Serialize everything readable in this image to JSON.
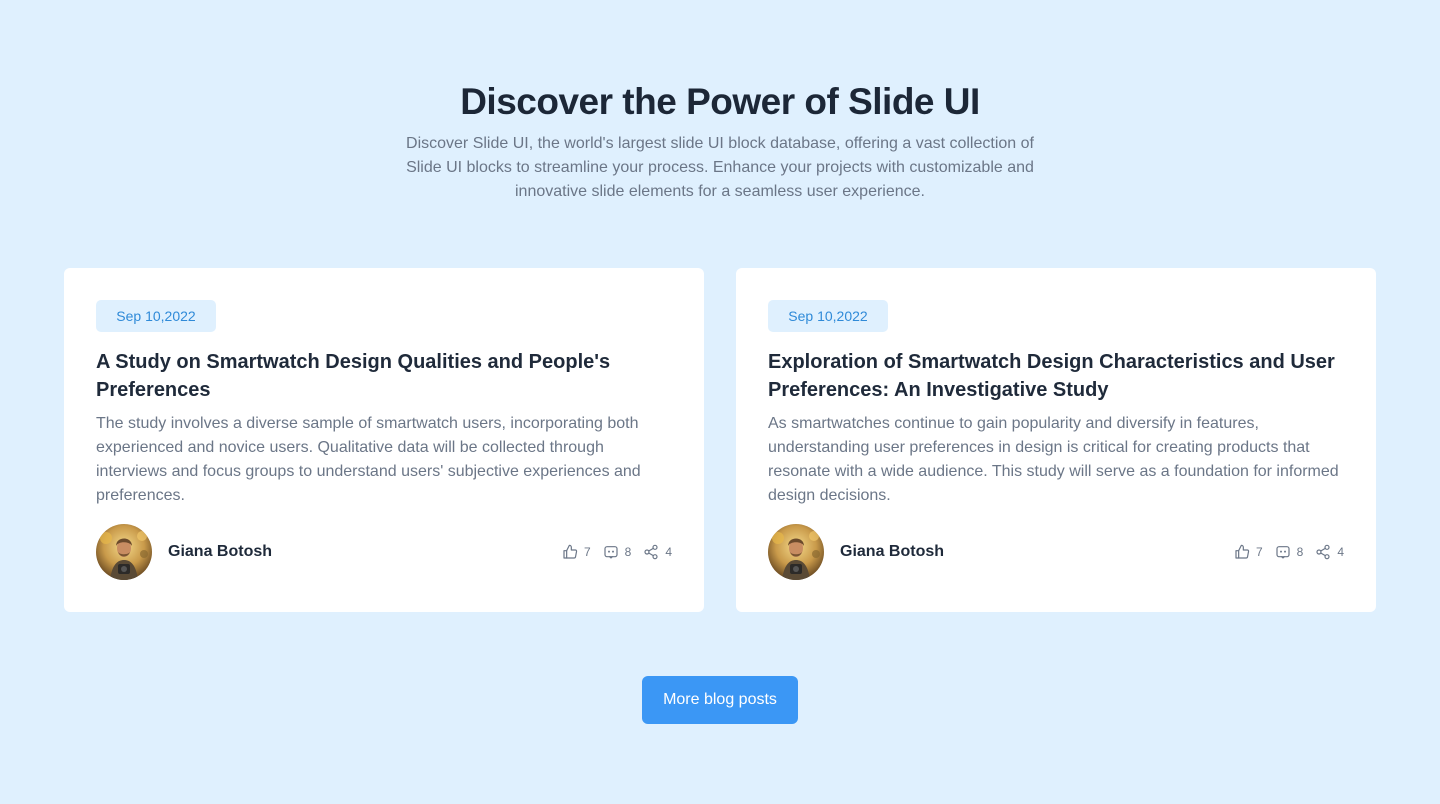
{
  "hero": {
    "title": "Discover the Power of Slide UI",
    "subtitle": "Discover Slide UI, the world's largest slide UI block database, offering a vast collection of Slide UI blocks to streamline your process. Enhance your projects with customizable and innovative slide elements for a seamless user experience."
  },
  "posts": [
    {
      "date": "Sep 10,2022",
      "title": "A Study on Smartwatch Design Qualities and People's Preferences",
      "excerpt": "The study involves a diverse sample of smartwatch users, incorporating both experienced and novice users. Qualitative data will be collected through interviews and focus groups to understand users' subjective experiences and preferences.",
      "author": "Giana Botosh",
      "likes": "7",
      "comments": "8",
      "shares": "4"
    },
    {
      "date": "Sep 10,2022",
      "title": "Exploration of Smartwatch Design Characteristics and User Preferences: An Investigative Study",
      "excerpt": "As smartwatches continue to gain popularity and diversify in features, understanding user preferences in design is critical for creating products that resonate with a wide audience. This study will serve as a foundation for informed design decisions.",
      "author": "Giana Botosh",
      "likes": "7",
      "comments": "8",
      "shares": "4"
    }
  ],
  "more_button": {
    "label": "More blog posts"
  },
  "icons": {
    "like": "thumbs-up-icon",
    "comment": "comment-icon",
    "share": "share-icon"
  },
  "colors": {
    "background": "#dff0fe",
    "accent": "#3b97f5",
    "badge_text": "#2f8ad8"
  }
}
